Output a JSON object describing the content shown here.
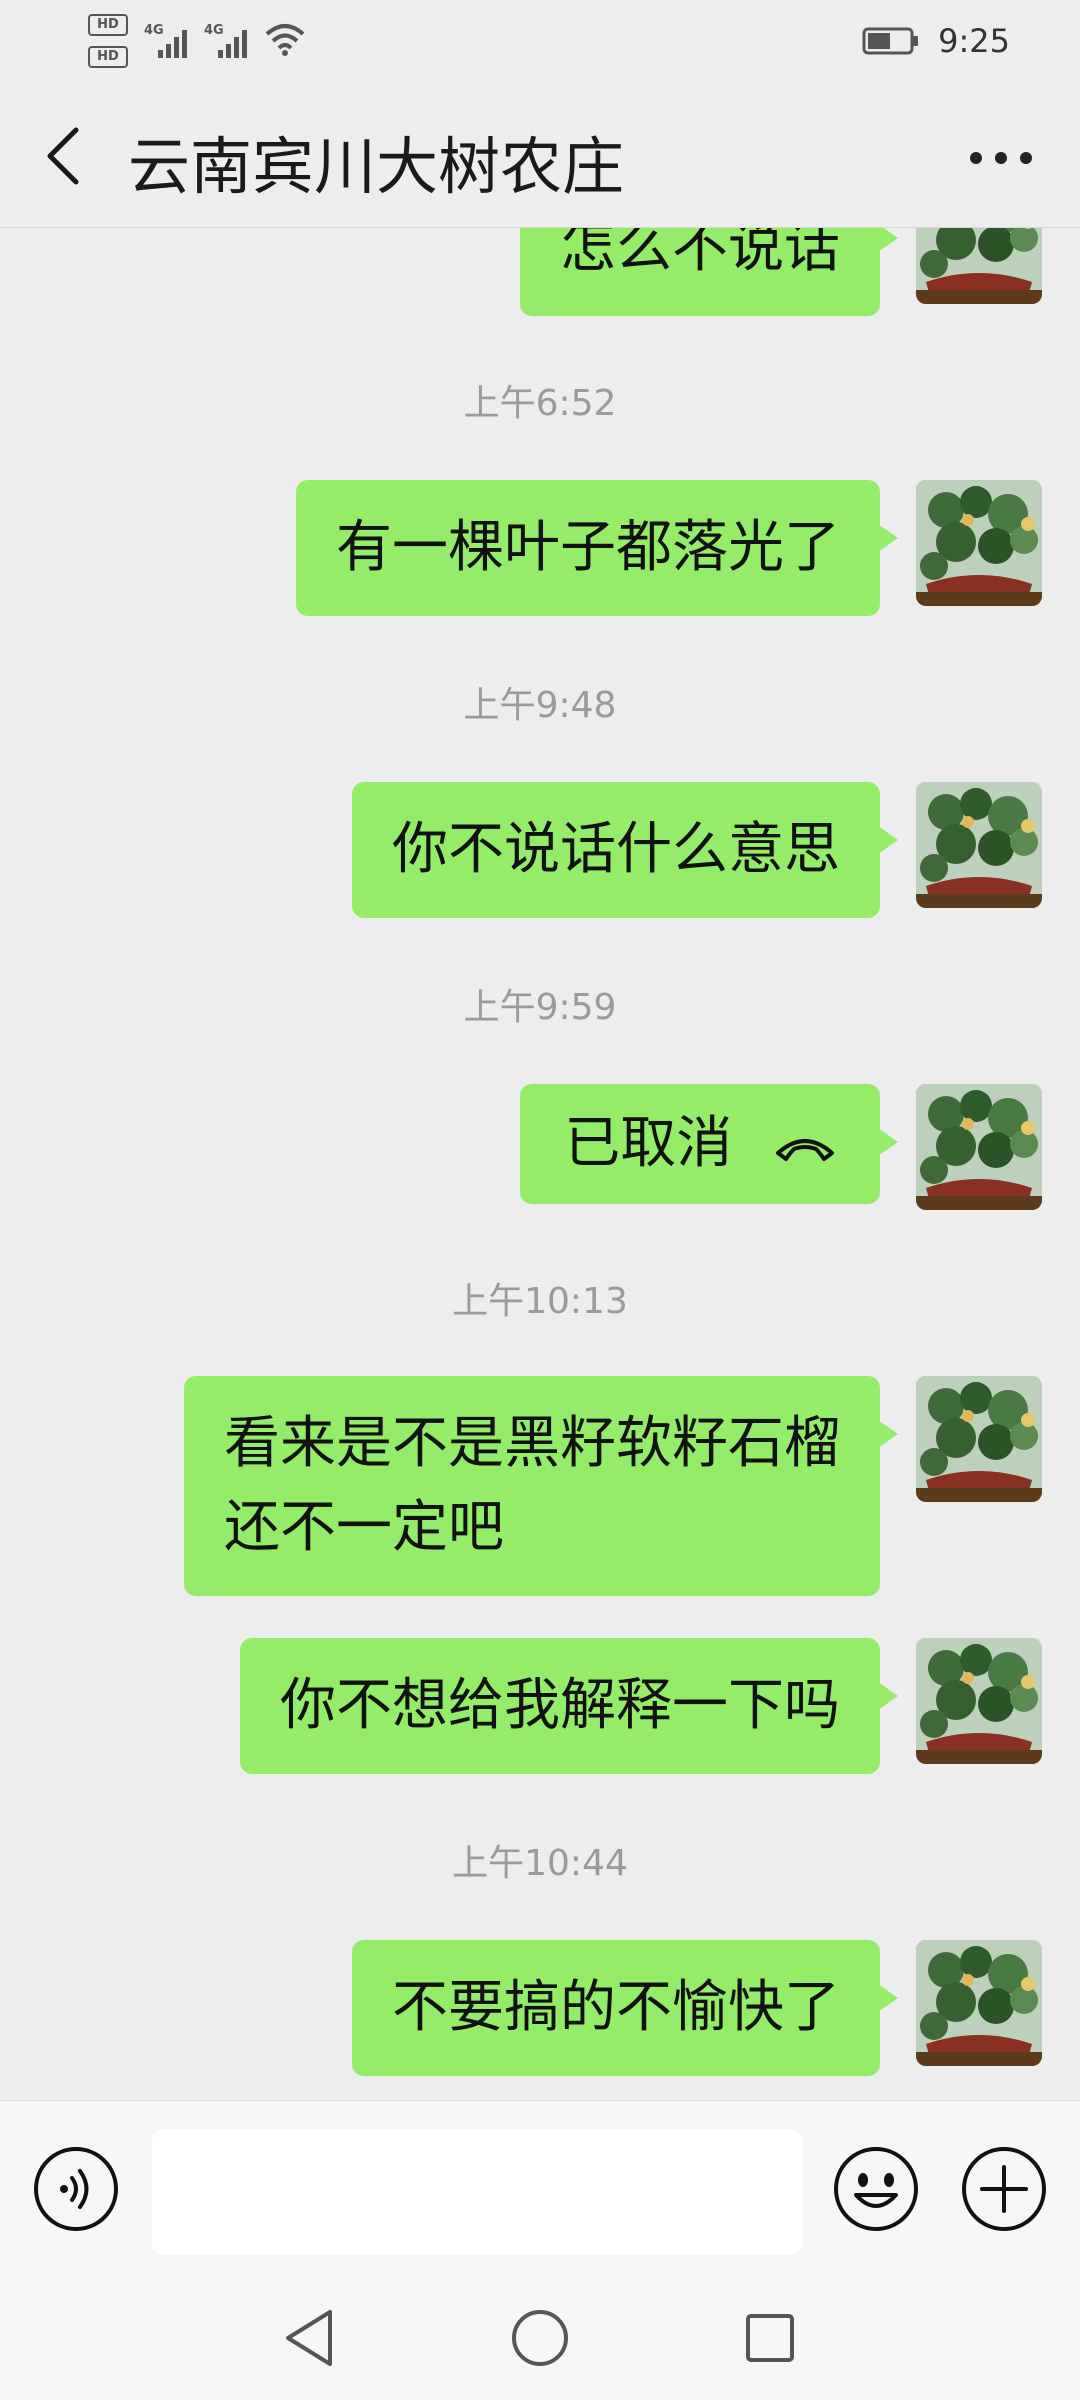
{
  "status_bar": {
    "hd1": "HD",
    "hd2": "HD",
    "sim1_net": "4G",
    "sim2_net": "4G",
    "time": "9:25"
  },
  "header": {
    "title": "云南宾川大树农庄"
  },
  "messages": [
    {
      "type": "text",
      "text": "怎么不说话"
    },
    {
      "type": "time",
      "text": "上午6:52"
    },
    {
      "type": "text",
      "text": "有一棵叶子都落光了"
    },
    {
      "type": "time",
      "text": "上午9:48"
    },
    {
      "type": "text",
      "text": "你不说话什么意思"
    },
    {
      "type": "time",
      "text": "上午9:59"
    },
    {
      "type": "call",
      "text": "已取消"
    },
    {
      "type": "time",
      "text": "上午10:13"
    },
    {
      "type": "text",
      "text": "看来是不是黑籽软籽石榴\n还不一定吧"
    },
    {
      "type": "text",
      "text": "你不想给我解释一下吗"
    },
    {
      "type": "time",
      "text": "上午10:44"
    },
    {
      "type": "text",
      "text": "不要搞的不愉快了"
    }
  ],
  "colors": {
    "bubble": "#95ec69",
    "background": "#ededed",
    "timestamp": "#9a9a9a"
  },
  "input": {
    "value": "",
    "placeholder": ""
  },
  "icons": {
    "back": "chevron-left-icon",
    "more": "more-dots-icon",
    "voice": "voice-icon",
    "emoji": "emoji-icon",
    "plus": "plus-icon",
    "call": "hangup-phone-icon"
  }
}
